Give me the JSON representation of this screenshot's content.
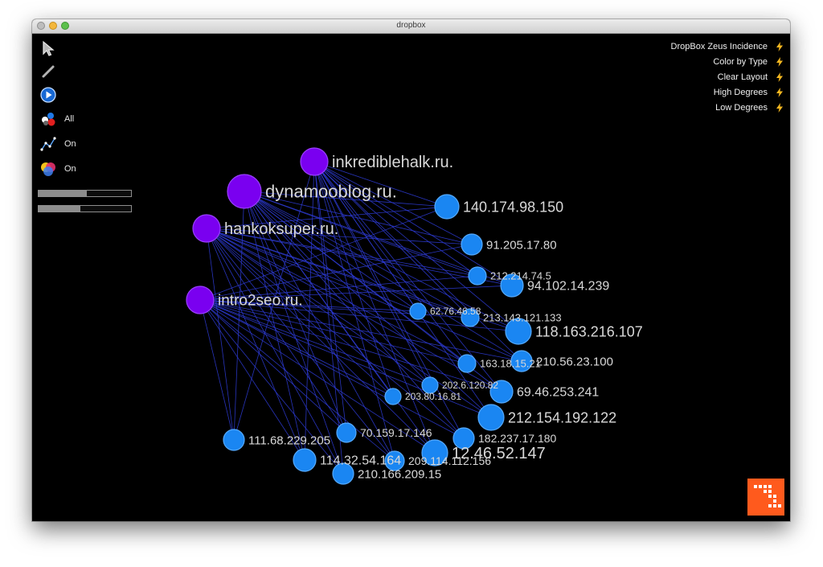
{
  "window": {
    "title": "dropbox"
  },
  "toolbar": {
    "filter_label": "All",
    "edges_label": "On",
    "colors_label": "On",
    "sliders": [
      0.52,
      0.45
    ]
  },
  "actions": [
    "DropBox Zeus Incidence",
    "Color by Type",
    "Clear Layout",
    "High Degrees",
    "Low Degrees"
  ],
  "colors": {
    "domain_node": "#7a00f0",
    "ip_node": "#1a86f2",
    "edge": "#2c3ad0",
    "accent": "#ff5a1d",
    "bolt": "#f5b820"
  },
  "graph": {
    "domains": [
      {
        "id": "inkrediblehalk",
        "label": "inkrediblehalk.ru."
      },
      {
        "id": "dynamooblog",
        "label": "dynamooblog.ru."
      },
      {
        "id": "hankoksuper",
        "label": "hankoksuper.ru."
      },
      {
        "id": "intro2seo",
        "label": "intro2seo.ru."
      }
    ],
    "ips": [
      {
        "id": "ip140",
        "label": "140.174.98.150"
      },
      {
        "id": "ip91",
        "label": "91.205.17.80"
      },
      {
        "id": "ip212a",
        "label": "212.214.74.5"
      },
      {
        "id": "ip94",
        "label": "94.102.14.239"
      },
      {
        "id": "ip62",
        "label": "62.76.46.58"
      },
      {
        "id": "ip213",
        "label": "213.143.121.133"
      },
      {
        "id": "ip118",
        "label": "118.163.216.107"
      },
      {
        "id": "ip163",
        "label": "163.18.15.21"
      },
      {
        "id": "ip210a",
        "label": "210.56.23.100"
      },
      {
        "id": "ip202",
        "label": "202.6.120.82"
      },
      {
        "id": "ip69",
        "label": "69.46.253.241"
      },
      {
        "id": "ip203",
        "label": "203.80.16.81"
      },
      {
        "id": "ip212b",
        "label": "212.154.192.122"
      },
      {
        "id": "ip111",
        "label": "111.68.229.205"
      },
      {
        "id": "ip70",
        "label": "70.159.17.146"
      },
      {
        "id": "ip182",
        "label": "182.237.17.180"
      },
      {
        "id": "ip12",
        "label": "12.46.52.147"
      },
      {
        "id": "ip114",
        "label": "114.32.54.164"
      },
      {
        "id": "ip209",
        "label": "209.114.112.156"
      },
      {
        "id": "ip210b",
        "label": "210.166.209.15"
      }
    ]
  }
}
